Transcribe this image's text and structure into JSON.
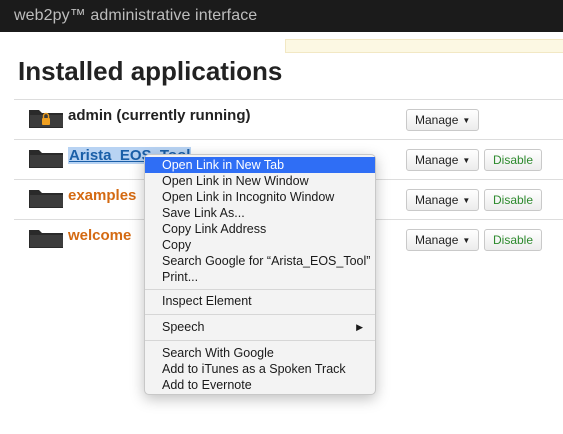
{
  "header": {
    "title": "web2py™ administrative interface"
  },
  "page": {
    "title": "Installed applications"
  },
  "apps": [
    {
      "name": "admin (currently running)",
      "manage_label": "Manage",
      "disable_label": null
    },
    {
      "name": "Arista_EOS_Tool",
      "manage_label": "Manage",
      "disable_label": "Disable"
    },
    {
      "name": "examples",
      "manage_label": "Manage",
      "disable_label": "Disable"
    },
    {
      "name": "welcome",
      "manage_label": "Manage",
      "disable_label": "Disable"
    }
  ],
  "context_menu": {
    "items": [
      "Open Link in New Tab",
      "Open Link in New Window",
      "Open Link in Incognito Window",
      "Save Link As...",
      "Copy Link Address",
      "Copy",
      "Search Google for “Arista_EOS_Tool”",
      "Print...",
      "Inspect Element",
      "Speech",
      "Search With Google",
      "Add to iTunes as a Spoken Track",
      "Add to Evernote"
    ]
  },
  "colors": {
    "app_link": "#d46a12",
    "disable_button_text": "#2d8a2d",
    "menu_highlight": "#2f6ef5",
    "selection": "#b8d3f3"
  },
  "icons": {
    "app": "folder-icon",
    "admin": "folder-lock-icon",
    "submenu": "triangle-right-icon",
    "dropdown": "caret-down-icon"
  }
}
